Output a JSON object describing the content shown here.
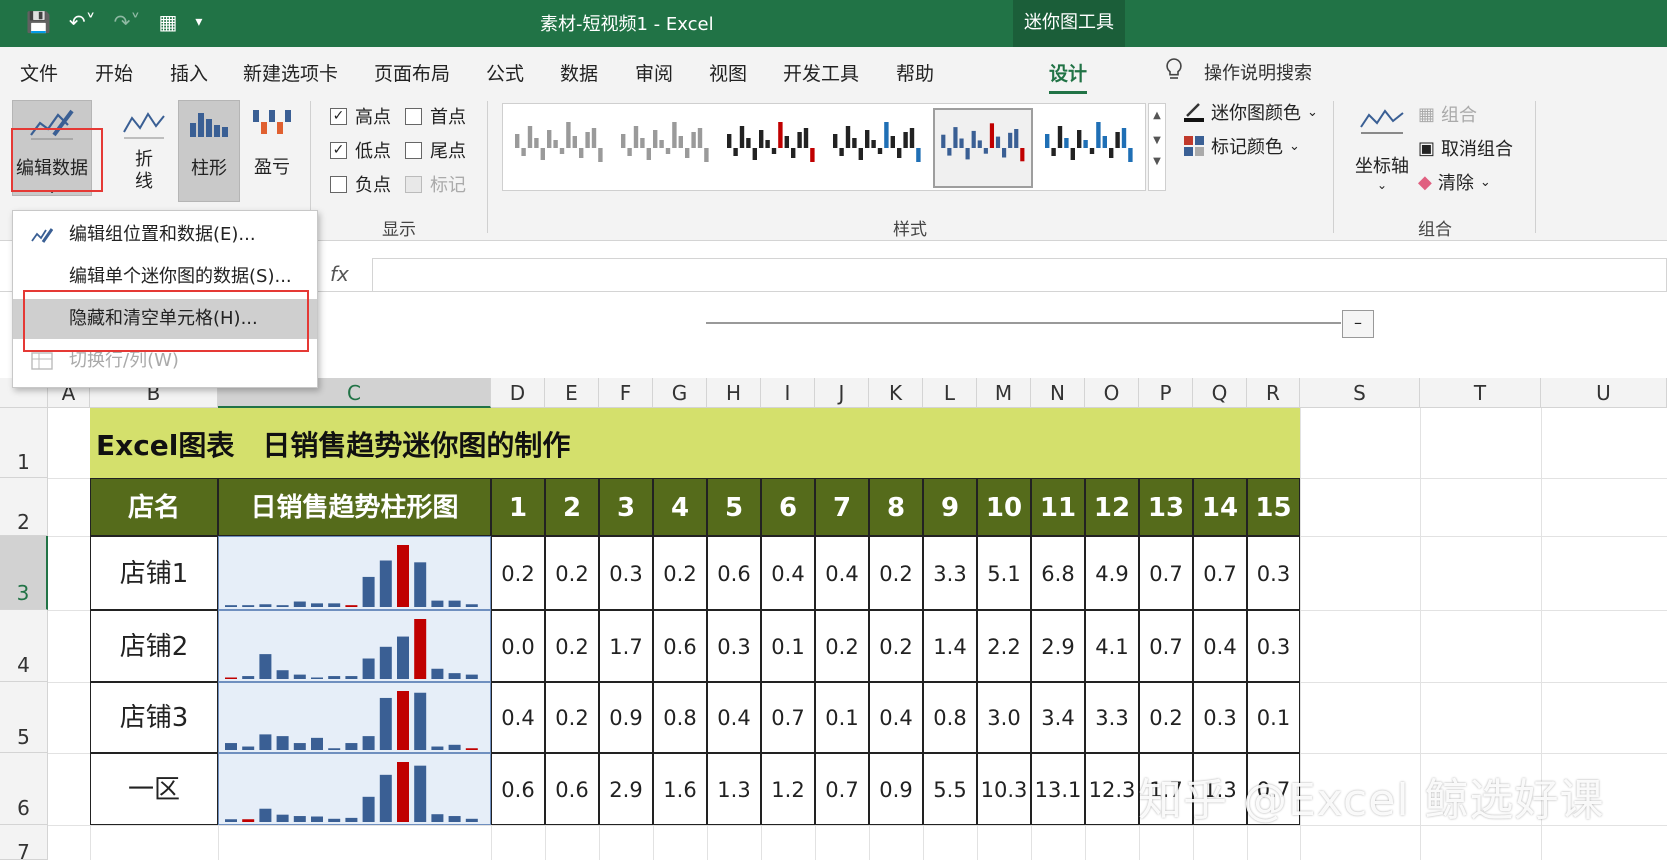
{
  "window": {
    "title": "素材-短视频1  -  Excel",
    "context_tab": "迷你图工具"
  },
  "tabs": [
    "文件",
    "开始",
    "插入",
    "新建选项卡",
    "页面布局",
    "公式",
    "数据",
    "审阅",
    "视图",
    "开发工具",
    "帮助",
    "设计"
  ],
  "active_tab": "设计",
  "tell_me": "操作说明搜索",
  "ribbon": {
    "edit_data": "编辑数据",
    "type_line_1": "折",
    "type_line_2": "线",
    "type_column": "柱形",
    "type_winloss": "盈亏",
    "show": {
      "high": "高点",
      "first": "首点",
      "low": "低点",
      "last": "尾点",
      "negative": "负点",
      "markers": "标记"
    },
    "show_label": "显示",
    "style_label": "样式",
    "sparkline_color": "迷你图颜色",
    "marker_color": "标记颜色",
    "axis": "坐标轴",
    "group": "组合",
    "ungroup": "取消组合",
    "clear": "清除",
    "group_label": "组合"
  },
  "dropdown": {
    "items": [
      "编辑组位置和数据(E)...",
      "编辑单个迷你图的数据(S)...",
      "隐藏和清空单元格(H)...",
      "切换行/列(W)"
    ]
  },
  "formula": {
    "fx": "fx"
  },
  "columns": [
    "A",
    "B",
    "C",
    "D",
    "E",
    "F",
    "G",
    "H",
    "I",
    "J",
    "K",
    "L",
    "M",
    "N",
    "O",
    "P",
    "Q",
    "R",
    "S",
    "T",
    "U"
  ],
  "rows": [
    "1",
    "2",
    "3",
    "4",
    "5",
    "6",
    "7"
  ],
  "sheet": {
    "title": "Excel图表　日销售趋势迷你图的制作",
    "header_store": "店名",
    "header_chart": "日销售趋势柱形图",
    "day_headers": [
      "1",
      "2",
      "3",
      "4",
      "5",
      "6",
      "7",
      "8",
      "9",
      "10",
      "11",
      "12",
      "13",
      "14",
      "15"
    ],
    "rows": [
      {
        "name": "店铺1",
        "values": [
          "0.2",
          "0.2",
          "0.3",
          "0.2",
          "0.6",
          "0.4",
          "0.4",
          "0.2",
          "3.3",
          "5.1",
          "6.8",
          "4.9",
          "0.7",
          "0.7",
          "0.3"
        ]
      },
      {
        "name": "店铺2",
        "values": [
          "0.0",
          "0.2",
          "1.7",
          "0.6",
          "0.3",
          "0.1",
          "0.2",
          "0.2",
          "1.4",
          "2.2",
          "2.9",
          "4.1",
          "0.7",
          "0.4",
          "0.3"
        ]
      },
      {
        "name": "店铺3",
        "values": [
          "0.4",
          "0.2",
          "0.9",
          "0.8",
          "0.4",
          "0.7",
          "0.1",
          "0.4",
          "0.8",
          "3.0",
          "3.4",
          "3.3",
          "0.2",
          "0.3",
          "0.1"
        ]
      },
      {
        "name": "一区",
        "values": [
          "0.6",
          "0.6",
          "2.9",
          "1.6",
          "1.3",
          "1.2",
          "0.7",
          "0.9",
          "5.5",
          "10.3",
          "13.1",
          "12.3",
          "1.7",
          "1.3",
          "0.7"
        ]
      }
    ]
  },
  "colors": {
    "excel_green": "#217346",
    "header_olive": "#556b1b",
    "title_lime": "#d4e06c",
    "bar_blue": "#3a5f94",
    "bar_high_red": "#c00000"
  },
  "watermark": "知乎 @Excel 鲸选好课"
}
